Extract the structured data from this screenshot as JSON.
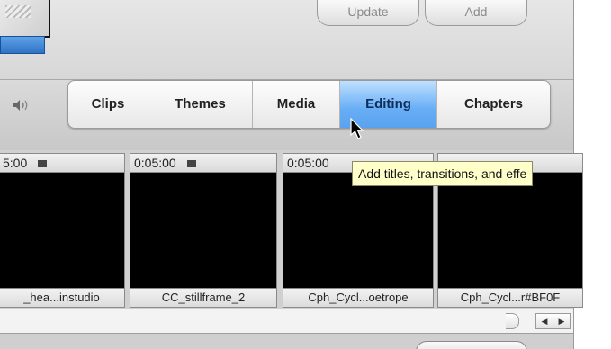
{
  "top": {
    "update_label": "Update",
    "add_label": "Add"
  },
  "tabs": [
    {
      "label": "Clips",
      "active": false
    },
    {
      "label": "Themes",
      "active": false
    },
    {
      "label": "Media",
      "active": false
    },
    {
      "label": "Editing",
      "active": true
    },
    {
      "label": "Chapters",
      "active": false
    }
  ],
  "clips": [
    {
      "time": "5:00",
      "name": "_hea...instudio"
    },
    {
      "time": "0:05:00",
      "name": "CC_stillframe_2"
    },
    {
      "time": "0:05:00",
      "name": "Cph_Cycl...oetrope"
    },
    {
      "time": "",
      "name": "Cph_Cycl...r#BF0F"
    }
  ],
  "tooltip": "Add titles, transitions, and effe",
  "colors": {
    "active_tab": "#5aa2f0",
    "tooltip_bg": "#ffffc9"
  }
}
